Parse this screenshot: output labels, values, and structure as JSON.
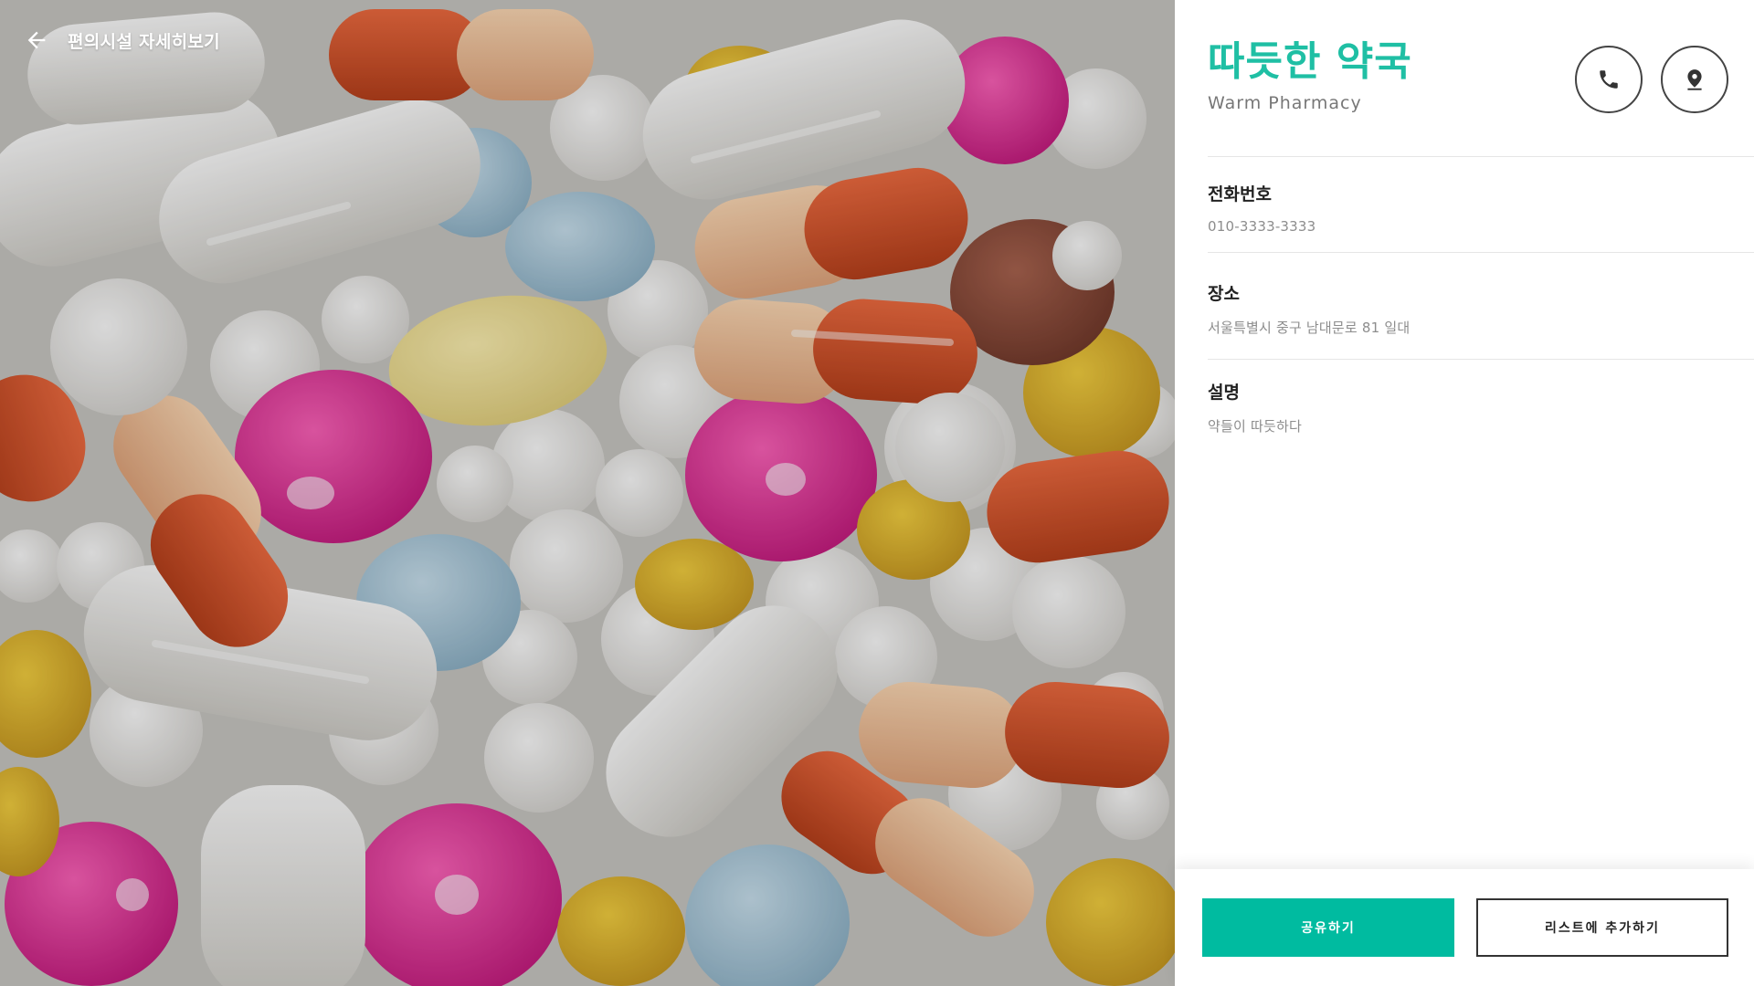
{
  "header": {
    "back_icon": "arrow-left-icon",
    "title": "편의시설 자세히보기"
  },
  "hero_image": {
    "subject": "pills"
  },
  "place": {
    "name_ko": "따듯한 약국",
    "name_en": "Warm Pharmacy",
    "actions": [
      {
        "icon": "phone-icon"
      },
      {
        "icon": "location-pin-icon"
      }
    ]
  },
  "fields": [
    {
      "label": "전화번호",
      "value": "010-3333-3333"
    },
    {
      "label": "장소",
      "value": "서울특별시 중구 남대문로 81 일대"
    },
    {
      "label": "설명",
      "value": "약들이 따듯하다"
    }
  ],
  "buttons": {
    "share_label": "공유하기",
    "add_to_list_label": "리스트에 추가하기"
  },
  "colors": {
    "accent": "#1fbfa4",
    "share_button": "#00bba0"
  }
}
